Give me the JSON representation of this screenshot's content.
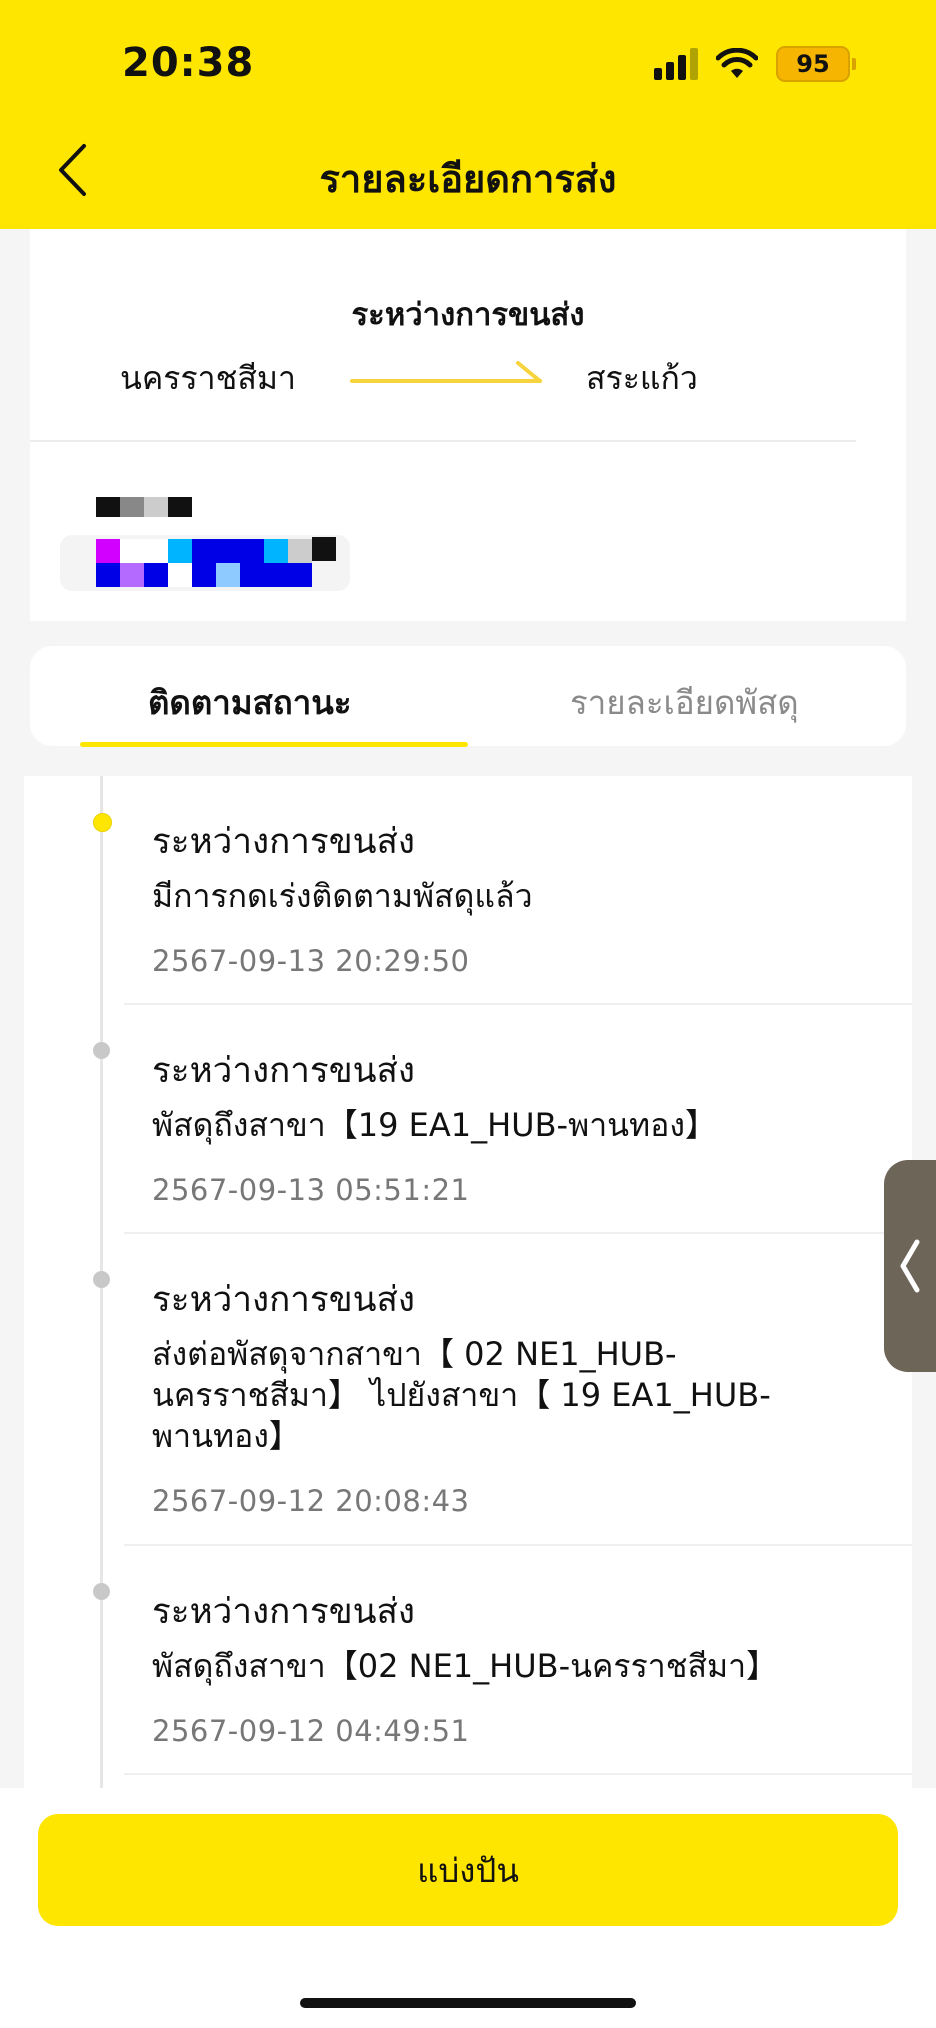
{
  "status_bar": {
    "time": "20:38",
    "battery": "95",
    "icons": [
      "cellular-signal-icon",
      "wifi-icon",
      "battery-icon"
    ]
  },
  "header": {
    "title": "รายละเอียดการส่ง",
    "back_icon": "chevron-left-icon"
  },
  "route": {
    "status": "ระหว่างการขนส่ง",
    "from": "นครราชสีมา",
    "to": "สระแก้ว",
    "arrow_icon": "arrow-right-icon"
  },
  "tabs": [
    {
      "label": "ติดตามสถานะ",
      "active": true
    },
    {
      "label": "รายละเอียดพัสดุ",
      "active": false
    }
  ],
  "events": [
    {
      "title": "ระหว่างการขนส่ง",
      "description": "มีการกดเร่งติดตามพัสดุแล้ว",
      "time": "2567-09-13 20:29:50",
      "current": true
    },
    {
      "title": "ระหว่างการขนส่ง",
      "description": "พัสดุถึงสาขา【19 EA1_HUB-พานทอง】",
      "time": "2567-09-13 05:51:21",
      "current": false
    },
    {
      "title": "ระหว่างการขนส่ง",
      "description_lines": [
        "ส่งต่อพัสดุจากสาขา【 02 NE1_HUB-",
        "นครราชสีมา】 ไปยังสาขา【 19 EA1_HUB-",
        "พานทอง】"
      ],
      "time": "2567-09-12 20:08:43",
      "current": false
    },
    {
      "title": "ระหว่างการขนส่ง",
      "description": "พัสดุถึงสาขา【02 NE1_HUB-นครราชสีมา】",
      "time": "2567-09-12 04:49:51",
      "current": false
    }
  ],
  "share_button": {
    "label": "แบ่งปัน"
  },
  "colors": {
    "brand_yellow": "#ffe600",
    "text_primary": "#111111",
    "text_secondary": "#777777",
    "tab_inactive": "#8a8a8a"
  }
}
